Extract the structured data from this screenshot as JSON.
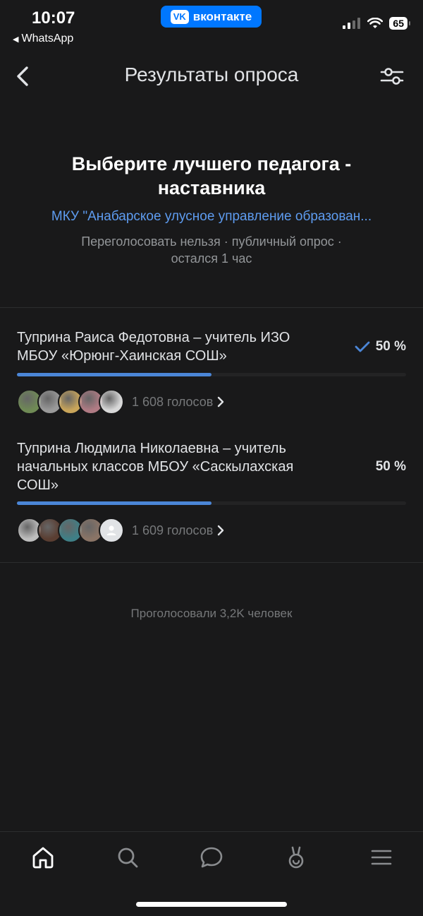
{
  "status_bar": {
    "time": "10:07",
    "back_app": "WhatsApp",
    "app_badge": "вконтакте",
    "app_badge_logo": "VK",
    "battery": "65"
  },
  "header": {
    "title": "Результаты опроса",
    "back_icon": "chevron-left-icon",
    "filter_icon": "sliders-icon"
  },
  "poll": {
    "question": "Выберите лучшего педагога - наставника",
    "author": "МКУ \"Анабарское улусное управление образован...",
    "meta": "Переголосовать нельзя · публичный опрос · остался 1 час"
  },
  "options": [
    {
      "text": "Туприна Раиса Федотовна – учитель ИЗО МБОУ «Юрюнг-Хаинская СОШ»",
      "percent_label": "50 %",
      "share": 0.5,
      "voted": true,
      "votes": "1 608 голосов",
      "avatar_colors": [
        "#6f8a55",
        "#9a9a9a",
        "#c9a55a",
        "#b07b84",
        "#d8d8d8"
      ]
    },
    {
      "text": "Туприна Людмила Николаевна – учитель начальных классов МБОУ «Саскылахская СОШ»",
      "percent_label": "50 %",
      "share": 0.5,
      "voted": false,
      "votes": "1 609 голосов",
      "avatar_colors": [
        "#bdbdbd",
        "#5a3e32",
        "#3f7f86",
        "#8a7466"
      ]
    }
  ],
  "total": "Проголосовали 3,2K человек",
  "tabbar": [
    "home-icon",
    "search-icon",
    "messages-icon",
    "clips-icon",
    "menu-icon"
  ],
  "colors": {
    "accent": "#4b86d7",
    "link": "#5e9cf0",
    "background": "#19191a",
    "vk_blue": "#0077ff"
  }
}
